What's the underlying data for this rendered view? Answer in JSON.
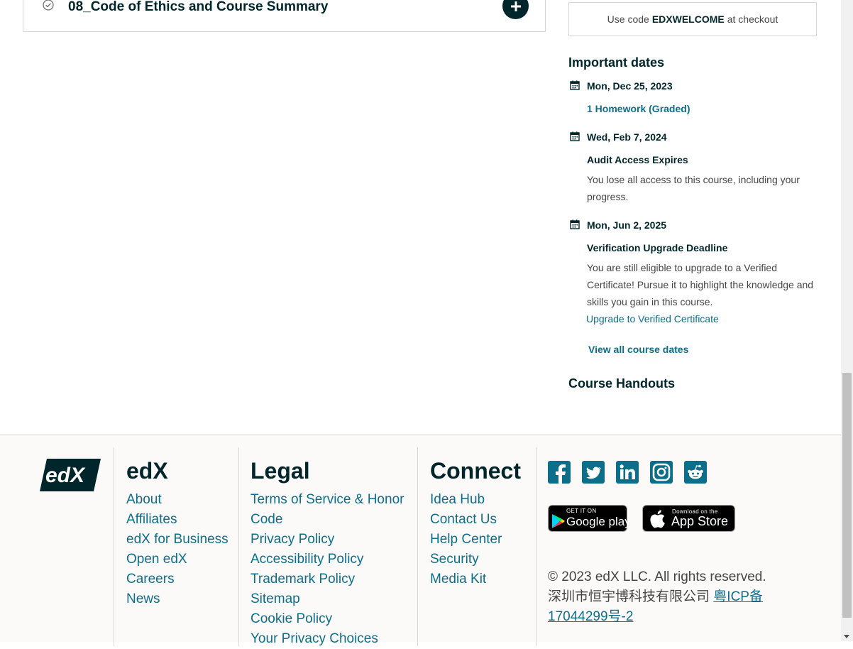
{
  "outline": {
    "section_title": "08_Code of Ethics and Course Summary"
  },
  "sidebar": {
    "promo_prefix": "Use code",
    "promo_code": "EDXWELCOME",
    "promo_suffix": "at checkout",
    "important_dates_heading": "Important dates",
    "dates": [
      {
        "date": "Mon, Dec 25, 2023",
        "link": "1 Homework (Graded)"
      },
      {
        "date": "Wed, Feb 7, 2024",
        "title": "Audit Access Expires",
        "description": "You lose all access to this course, including your progress."
      },
      {
        "date": "Mon, Jun 2, 2025",
        "title": "Verification Upgrade Deadline",
        "description": "You are still eligible to upgrade to a Verified Certificate! Pursue it to highlight the knowledge and skills you gain in this course.",
        "link": "Upgrade to Verified Certificate"
      }
    ],
    "view_all_label": "View all course dates",
    "handouts_heading": "Course Handouts"
  },
  "footer": {
    "logo_text": "edX",
    "columns": [
      {
        "heading": "edX",
        "links": [
          "About",
          "Affiliates",
          "edX for Business",
          "Open edX",
          "Careers",
          "News"
        ]
      },
      {
        "heading": "Legal",
        "links": [
          "Terms of Service & Honor Code",
          "Privacy Policy",
          "Accessibility Policy",
          "Trademark Policy",
          "Sitemap",
          "Cookie Policy",
          "Your Privacy Choices"
        ]
      },
      {
        "heading": "Connect",
        "links": [
          "Idea Hub",
          "Contact Us",
          "Help Center",
          "Security",
          "Media Kit"
        ]
      }
    ],
    "social_icons": [
      "facebook-icon",
      "twitter-icon",
      "linkedin-icon",
      "instagram-icon",
      "reddit-icon"
    ],
    "google_play": {
      "small": "GET IT ON",
      "big": "Google play"
    },
    "app_store": {
      "small": "Download on the",
      "big": "App Store"
    },
    "copyright": "© 2023 edX LLC. All rights reserved.",
    "icp_company": "深圳市恒宇博科技有限公司",
    "icp_link": "粤ICP备17044299号-2"
  },
  "colors": {
    "primary_dark": "#00262b",
    "link": "#0d6e8a",
    "border": "#d7d7d7",
    "footer_bg": "#fbfaf9"
  }
}
